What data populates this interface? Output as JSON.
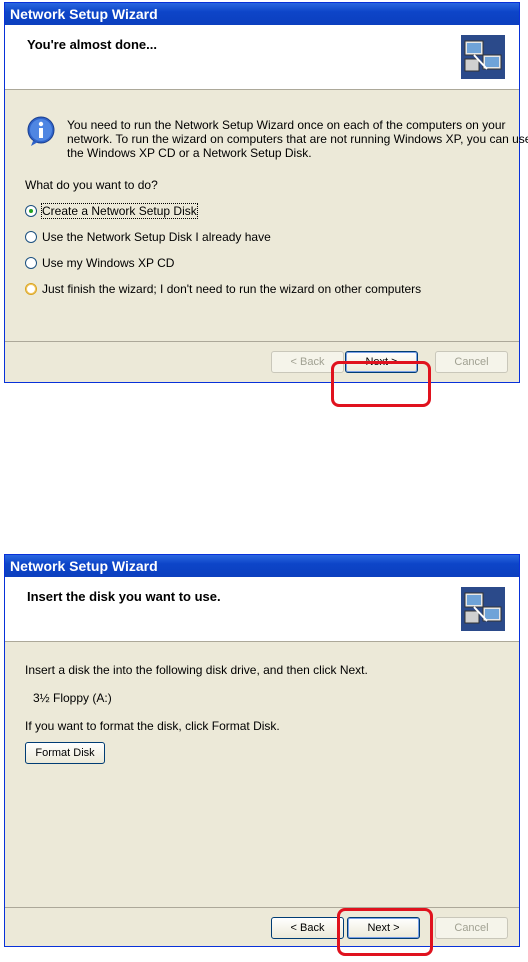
{
  "dialog1": {
    "title": "Network Setup Wizard",
    "heading": "You're almost done...",
    "info_text_1": "You need to run the Network Setup Wizard once on each of the computers on your",
    "info_text_2": "network. To run the wizard on computers that are not running Windows XP, you can use",
    "info_text_3": "the Windows XP CD or a Network Setup Disk.",
    "question": "What do you want to do?",
    "options": [
      {
        "label": "Create a Network Setup Disk",
        "selected": true
      },
      {
        "label": "Use the Network Setup Disk I already have",
        "selected": false
      },
      {
        "label": "Use my Windows XP CD",
        "selected": false
      },
      {
        "label": "Just finish the wizard; I don't need to run the wizard on other computers",
        "selected": false
      }
    ],
    "back_label": "< Back",
    "next_label": "Next >",
    "cancel_label": "Cancel"
  },
  "dialog2": {
    "title": "Network Setup Wizard",
    "heading": "Insert the disk you want to use.",
    "instruction": "Insert a disk the into the following disk drive, and then click Next.",
    "drive": "3½ Floppy (A:)",
    "format_hint": "If you want to format the disk, click Format Disk.",
    "format_button": "Format Disk",
    "back_label": "< Back",
    "next_label": "Next >",
    "cancel_label": "Cancel"
  },
  "colors": {
    "highlight": "#e0121e",
    "titlebar": "#0d45c8",
    "dialog_bg": "#ece9d8"
  }
}
